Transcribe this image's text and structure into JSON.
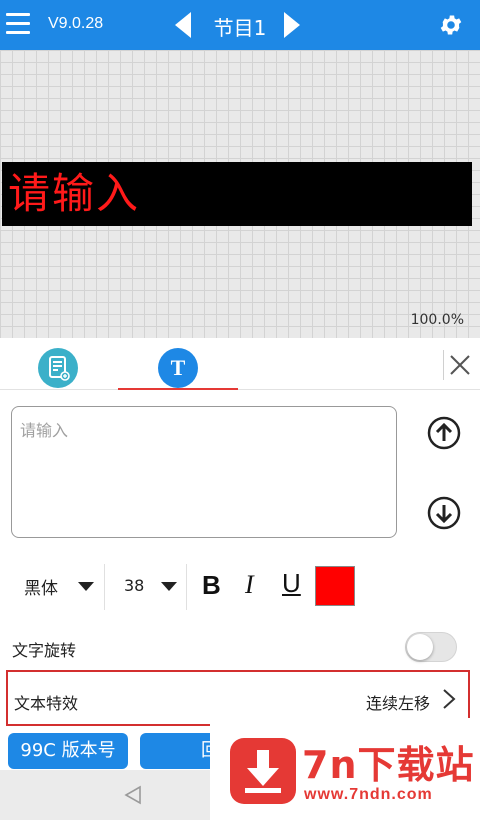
{
  "topbar": {
    "version": "V9.0.28",
    "program_title": "节目1",
    "menu_icon": "hamburger-menu-icon",
    "settings_icon": "gear-icon",
    "bg_color": "#1e88e5"
  },
  "canvas": {
    "led_text": "请输入",
    "led_text_color": "#ff1a1a",
    "zoom": "100.0%"
  },
  "panel": {
    "tabs": [
      {
        "icon": "program-list-icon",
        "active": false
      },
      {
        "icon": "text-t-icon",
        "label": "T",
        "active": true
      }
    ],
    "text_input": {
      "placeholder": "请输入",
      "value": ""
    },
    "font": "黑体",
    "font_size": "38",
    "bold": "B",
    "italic": "I",
    "underline": "U",
    "text_color": "#ff0000",
    "rotate_label": "文字旋转",
    "rotate_on": false,
    "effect_label": "文本特效",
    "effect_value": "连续左移",
    "btn_version": "99C 版本号",
    "btn_back": "回"
  },
  "watermark": {
    "title": "7n下载站",
    "url": "www.7ndn.com",
    "color": "#e53935"
  }
}
